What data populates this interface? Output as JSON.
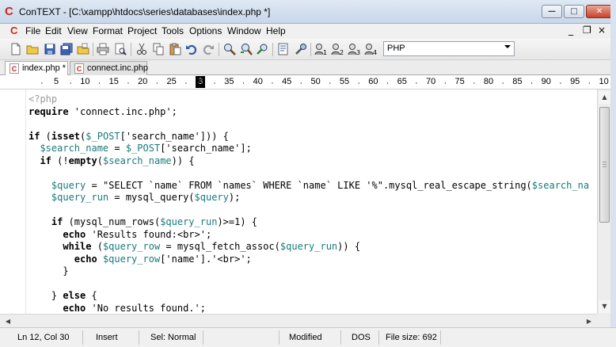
{
  "window": {
    "title": "ConTEXT - [C:\\xampp\\htdocs\\series\\databases\\index.php *]",
    "controls": {
      "minimize": "—",
      "maximize": "□",
      "close": "✕"
    }
  },
  "menu": {
    "items": [
      "File",
      "Edit",
      "View",
      "Format",
      "Project",
      "Tools",
      "Options",
      "Window",
      "Help"
    ],
    "mdi_controls": {
      "minimize": "_",
      "restore": "❐",
      "close": "×"
    }
  },
  "toolbar": {
    "icons": [
      "new-file-icon",
      "open-folder-icon",
      "save-icon",
      "save-all-icon",
      "open-project-icon",
      "print-icon",
      "print-preview-icon",
      "cut-icon",
      "copy-icon",
      "paste-icon",
      "undo-icon",
      "redo-icon",
      "find-icon",
      "find-next-icon",
      "replace-icon",
      "file-properties-icon",
      "tool-icon",
      "user-command-1-icon",
      "user-command-2-icon",
      "user-command-3-icon",
      "user-command-4-icon"
    ],
    "highlighter": "PHP",
    "user_command_numbers": [
      "1",
      "2",
      "3",
      "4"
    ]
  },
  "tabs": [
    {
      "label": "index.php *",
      "active": true
    },
    {
      "label": "connect.inc.php",
      "active": false
    }
  ],
  "ruler": {
    "numbers": [
      "5",
      "10",
      "15",
      "20",
      "25",
      "30",
      "35",
      "40",
      "45",
      "50",
      "55",
      "60",
      "65",
      "70",
      "75",
      "80",
      "85",
      "90",
      "95",
      "10"
    ],
    "cursor_column": 30
  },
  "code": {
    "lines": [
      "<?php",
      "require 'connect.inc.php';",
      "",
      "if (isset($_POST['search_name'])) {",
      "  $search_name = $_POST['search_name'];",
      "  if (!empty($search_name)) {",
      "",
      "    $query = \"SELECT `name` FROM `names` WHERE `name` LIKE '%\".mysql_real_escape_string($search_na",
      "    $query_run = mysql_query($query);",
      "",
      "    if (mysql_num_rows($query_run)>=1) {",
      "      echo 'Results found:<br>';",
      "      while ($query_row = mysql_fetch_assoc($query_run)) {",
      "        echo $query_row['name'].'<br>';",
      "      }",
      "",
      "    } else {",
      "      echo 'No results found.';"
    ]
  },
  "status": {
    "position": "Ln 12, Col 30",
    "mode": "Insert",
    "selection": "Sel: Normal",
    "modified": "Modified",
    "line_endings": "DOS",
    "file_size": "File size: 692"
  },
  "colors": {
    "variable": "#1a7a7a",
    "title_bar": "#c9d7ea",
    "app_icon": "#c8281e"
  }
}
